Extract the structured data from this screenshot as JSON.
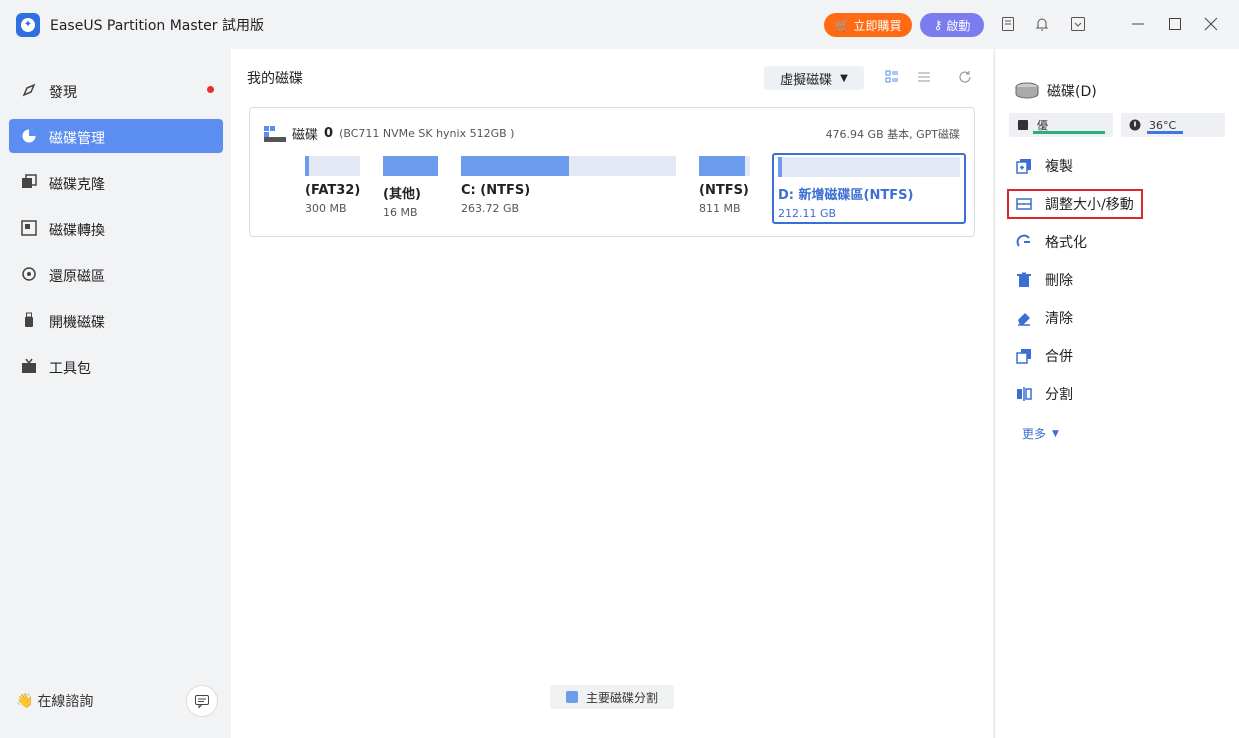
{
  "app": {
    "title": "EaseUS Partition Master 試用版",
    "buy_label": "立即購買",
    "activate_label": "啟動"
  },
  "sidebar": {
    "items": [
      {
        "label": "發現",
        "icon": "compass-icon"
      },
      {
        "label": "磁碟管理",
        "icon": "pie-chart-icon"
      },
      {
        "label": "磁碟克隆",
        "icon": "clone-icon"
      },
      {
        "label": "磁碟轉換",
        "icon": "convert-icon"
      },
      {
        "label": "還原磁區",
        "icon": "recover-icon"
      },
      {
        "label": "開機磁碟",
        "icon": "usb-icon"
      },
      {
        "label": "工具包",
        "icon": "toolbox-icon"
      }
    ],
    "consult_label": "在線諮詢"
  },
  "main": {
    "title": "我的磁碟",
    "virtual_disk_label": "虛擬磁碟",
    "disk": {
      "name": "磁碟",
      "index": "0",
      "model": "(BC711 NVMe SK hynix 512GB )",
      "info": "476.94 GB 基本, GPT磁碟",
      "partitions": [
        {
          "name": "(FAT32)",
          "size": "300 MB",
          "used": 0.08
        },
        {
          "name": "(其他)",
          "size": "16 MB",
          "used": 1.0
        },
        {
          "name": "C: (NTFS)",
          "size": "263.72 GB",
          "used": 0.5
        },
        {
          "name": "(NTFS)",
          "size": "811 MB",
          "used": 0.9
        },
        {
          "name": "D: 新增磁碟區(NTFS)",
          "size": "212.11 GB",
          "used": 0.01
        }
      ]
    },
    "legend_label": "主要磁碟分割"
  },
  "right_panel": {
    "title": "磁碟(D)",
    "health_label": "優",
    "temp_label": "36°C",
    "actions": [
      {
        "label": "複製",
        "icon": "copy-icon"
      },
      {
        "label": "調整大小/移動",
        "icon": "resize-icon"
      },
      {
        "label": "格式化",
        "icon": "format-icon"
      },
      {
        "label": "刪除",
        "icon": "trash-icon"
      },
      {
        "label": "清除",
        "icon": "eraser-icon"
      },
      {
        "label": "合併",
        "icon": "merge-icon"
      },
      {
        "label": "分割",
        "icon": "split-icon"
      }
    ],
    "more_label": "更多"
  },
  "colors": {
    "accent": "#5b8ef0",
    "buy": "#ff6a13",
    "activate": "#7b7cf0",
    "highlight": "#d9272e"
  }
}
